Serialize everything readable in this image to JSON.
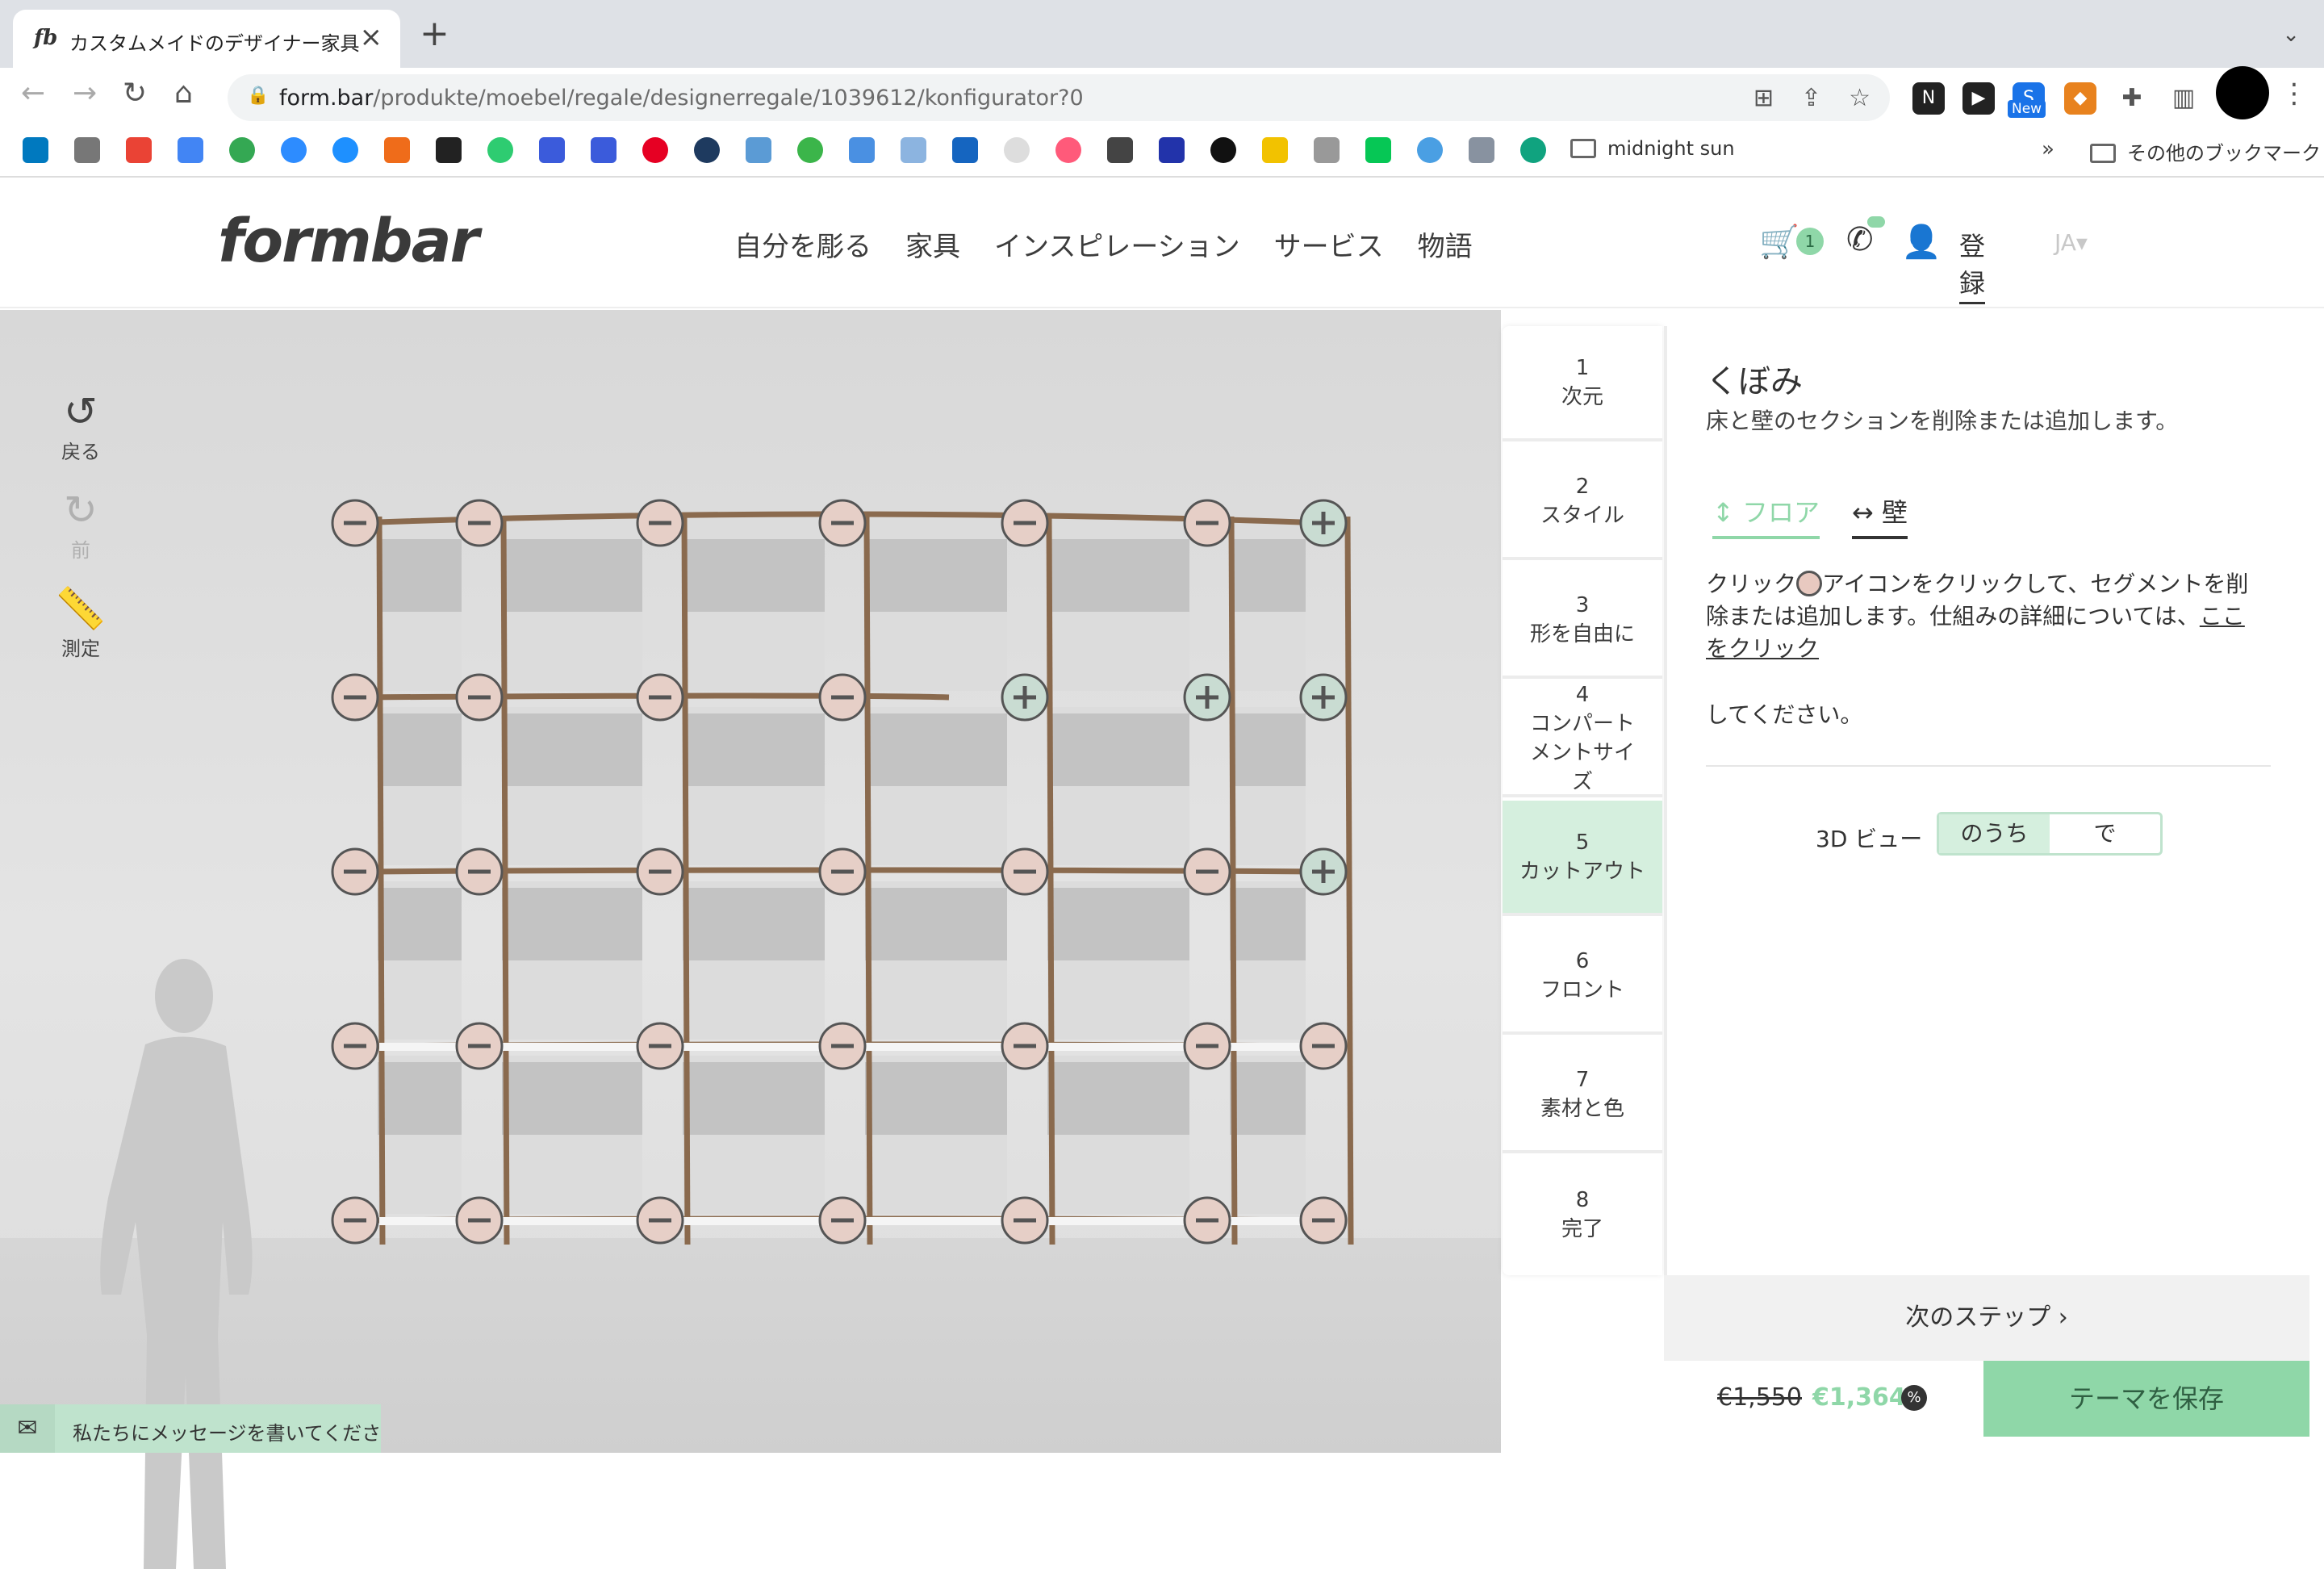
{
  "browser": {
    "tab_title": "カスタムメイドのデザイナー家具の",
    "favicon_text": "fb",
    "url_host": "form.bar",
    "url_path": "/produkte/moebel/regale/designerregale/1039612/konfigurator?0",
    "new_badge": "New",
    "bookmark_folder": "midnight sun",
    "other_bookmarks": "その他のブックマーク"
  },
  "header": {
    "logo": "formbar",
    "nav": [
      "自分を彫る",
      "家具",
      "インスピレーション",
      "サービス",
      "物語"
    ],
    "cart_count": "1",
    "register": "登録",
    "lang": "JA"
  },
  "tools": {
    "undo": "戻る",
    "redo": "前",
    "measure": "測定"
  },
  "steps": [
    {
      "num": "1",
      "label": "次元"
    },
    {
      "num": "2",
      "label": "スタイル"
    },
    {
      "num": "3",
      "label": "形を自由に"
    },
    {
      "num": "4",
      "label": "コンパートメントサイズ"
    },
    {
      "num": "5",
      "label": "カットアウト"
    },
    {
      "num": "6",
      "label": "フロント"
    },
    {
      "num": "7",
      "label": "素材と色"
    },
    {
      "num": "8",
      "label": "完了"
    }
  ],
  "active_step": 5,
  "panel": {
    "title": "くぼみ",
    "subtitle": "床と壁のセクションを削除または追加します。",
    "tab_floor": "フロア",
    "tab_wall": "壁",
    "info_a": "クリック",
    "info_b": "アイコンをクリックして、セグメントを削除または追加します。仕組みの詳細については、",
    "info_link": "ここをクリック",
    "info_c": "してください。",
    "view3d_label": "3D ビュー",
    "view3d_on": "のうち",
    "view3d_off": "で"
  },
  "footer": {
    "next_step": "次のステップ",
    "old_price": "€1,550",
    "new_price": "€1,364",
    "pct": "%",
    "save": "テーマを保存",
    "message": "私たちにメッセージを書いてくださ"
  },
  "colors": {
    "accent_green": "#8fd7a8",
    "active_step_bg": "#d5efde",
    "frame_brown": "#8a6a4e"
  }
}
